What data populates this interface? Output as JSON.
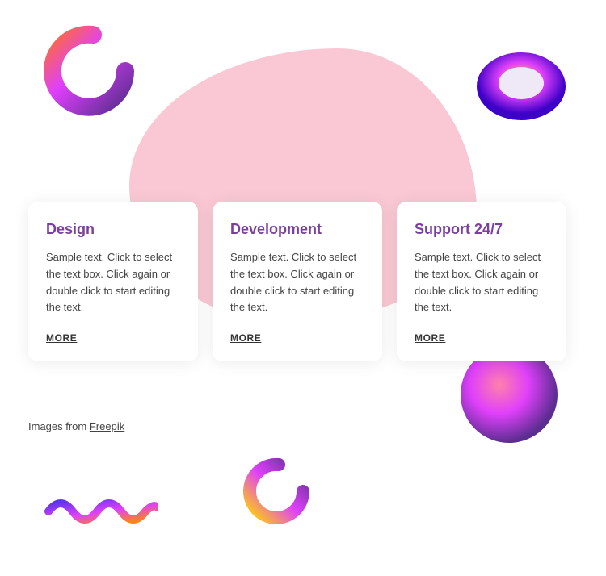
{
  "blob": {
    "label": "decorative-blob"
  },
  "cards": [
    {
      "title": "Design",
      "text": "Sample text. Click to select the text box. Click again or double click to start editing the text.",
      "more": "MORE"
    },
    {
      "title": "Development",
      "text": "Sample text. Click to select the text box. Click again or double click to start editing the text.",
      "more": "MORE"
    },
    {
      "title": "Support 24/7",
      "text": "Sample text. Click to select the text box. Click again or double click to start editing the text.",
      "more": "MORE"
    }
  ],
  "footer": {
    "prefix": "Images from ",
    "link_text": "Freepik"
  }
}
